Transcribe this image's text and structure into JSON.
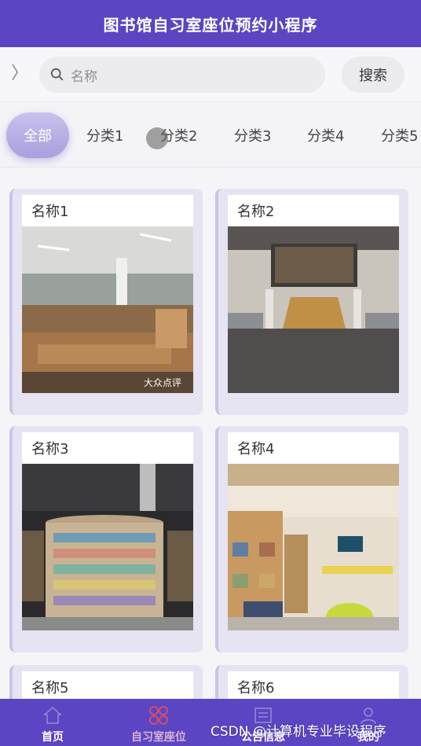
{
  "header": {
    "title": "图书馆自习室座位预约小程序"
  },
  "search": {
    "placeholder": "名称",
    "button_label": "搜索"
  },
  "categories": [
    "全部",
    "分类1",
    "分类2",
    "分类3",
    "分类4",
    "分类5"
  ],
  "cards": [
    {
      "name": "名称1",
      "image_caption": "大众点评"
    },
    {
      "name": "名称2"
    },
    {
      "name": "名称3"
    },
    {
      "name": "名称4"
    },
    {
      "name": "名称5"
    },
    {
      "name": "名称6"
    }
  ],
  "tabbar": {
    "items": [
      {
        "label": "首页",
        "icon": "home-icon"
      },
      {
        "label": "自习室座位",
        "icon": "seat-grid-icon"
      },
      {
        "label": "公告信息",
        "icon": "notice-icon"
      },
      {
        "label": "我的",
        "icon": "user-icon"
      }
    ]
  },
  "watermark": "CSDN @计算机专业毕设程序",
  "colors": {
    "header": "#5b45c2",
    "active_tab": "#d9b4d8",
    "active_category": "#b3aae3"
  }
}
